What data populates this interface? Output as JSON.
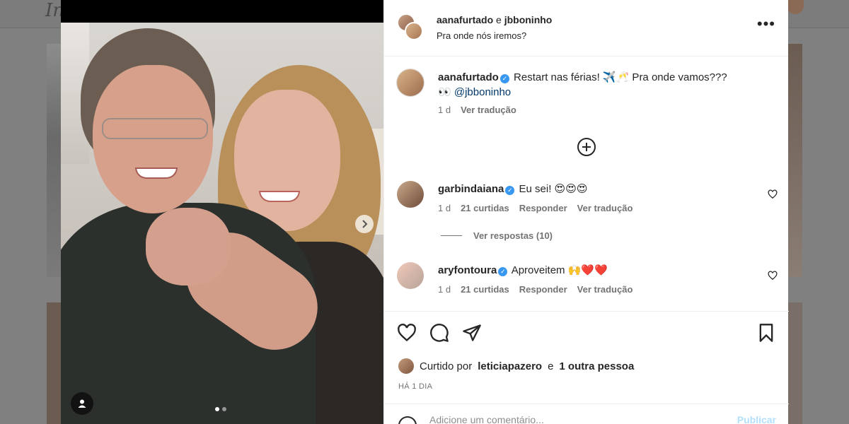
{
  "background": {
    "logo": "In"
  },
  "post": {
    "photo_alt": "selfie",
    "carousel": {
      "total": 2,
      "current": 1
    }
  },
  "header": {
    "user1": "aanafurtado",
    "conjunction": "e",
    "user2": "jbboninho",
    "subtitle": "Pra onde nós iremos?"
  },
  "caption": {
    "username": "aanafurtado",
    "text": "Restart nas férias! ✈️🥂 Pra onde vamos???",
    "line2_emoji": "👀",
    "mention": "@jbboninho",
    "time": "1 d",
    "translate": "Ver tradução"
  },
  "comments": [
    {
      "username": "garbindaiana",
      "text": "Eu sei! 😍😍😍",
      "time": "1 d",
      "likes": "21 curtidas",
      "reply": "Responder",
      "translate": "Ver tradução"
    },
    {
      "username": "aryfontoura",
      "text": "Aproveitem 🙌❤️❤️",
      "time": "1 d",
      "likes": "21 curtidas",
      "reply": "Responder",
      "translate": "Ver tradução"
    }
  ],
  "replies_link": "Ver respostas (10)",
  "likes": {
    "prefix": "Curtido por",
    "user": "leticiapazero",
    "conjunction": "e",
    "others": "1 outra pessoa"
  },
  "date": "HÁ 1 DIA",
  "add_comment": {
    "placeholder": "Adicione um comentário...",
    "publish": "Publicar"
  },
  "colors": {
    "accent": "#3897f0",
    "mention": "#00376b",
    "publish_disabled": "#b2dffc"
  }
}
